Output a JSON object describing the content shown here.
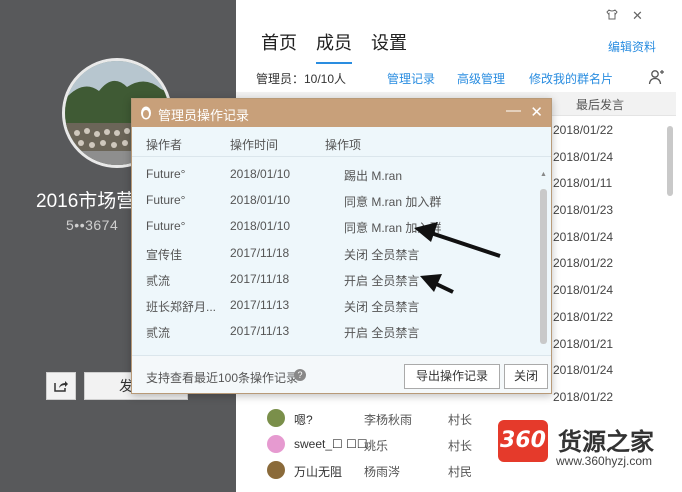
{
  "window": {
    "skin_icon": "shirt-icon",
    "close_glyph": "✕"
  },
  "left": {
    "group_name": "2016市场营",
    "group_id": "5••3674",
    "send_label": "发"
  },
  "tabs": [
    {
      "label": "首页"
    },
    {
      "label": "成员"
    },
    {
      "label": "设置"
    }
  ],
  "edit_profile": "编辑资料",
  "admin_bar": {
    "count": "管理员：10/10人",
    "records": "管理记录",
    "advanced": "高级管理",
    "my_card": "修改我的群名片"
  },
  "member_list": {
    "last_header": "最后发言",
    "last_dates": [
      "2018/01/22",
      "2018/01/24",
      "2018/01/11",
      "2018/01/23",
      "2018/01/24",
      "2018/01/22",
      "2018/01/24",
      "2018/01/22",
      "2018/01/21",
      "2018/01/24",
      "2018/01/22"
    ],
    "members": [
      {
        "nick": "嗯?",
        "card": "李杨秋雨",
        "role": "村长",
        "avatar_color": "#7a8f4a"
      },
      {
        "nick": "sweet_☐ ☐☐",
        "card": "姚乐",
        "role": "村长",
        "avatar_color": "#e69ad0"
      },
      {
        "nick": "万山无阻",
        "card": "杨雨涔",
        "role": "村民",
        "avatar_color": "#8a6a3a"
      }
    ]
  },
  "dialog": {
    "title": "管理员操作记录",
    "minimize_glyph": "—",
    "close_glyph": "✕",
    "columns": [
      "操作者",
      "操作时间",
      "操作项"
    ],
    "rows": [
      {
        "operator": "Future°",
        "time": "2018/01/10",
        "action": "踢出 M.ran"
      },
      {
        "operator": "Future°",
        "time": "2018/01/10",
        "action": "同意 M.ran 加入群"
      },
      {
        "operator": "Future°",
        "time": "2018/01/10",
        "action": "同意 M.ran 加入群"
      },
      {
        "operator": "宣传佳",
        "time": "2017/11/18",
        "action": "关闭 全员禁言"
      },
      {
        "operator": "贰流",
        "time": "2017/11/18",
        "action": "开启 全员禁言"
      },
      {
        "operator": "班长郑舒月...",
        "time": "2017/11/13",
        "action": "关闭 全员禁言"
      },
      {
        "operator": "贰流",
        "time": "2017/11/13",
        "action": "开启 全员禁言"
      }
    ],
    "footer_hint": "支持查看最近100条操作记录",
    "export_label": "导出操作记录",
    "close_label": "关闭"
  },
  "watermark": {
    "logo": "360",
    "text": "货源之家",
    "url": "www.360hyzj.com"
  }
}
